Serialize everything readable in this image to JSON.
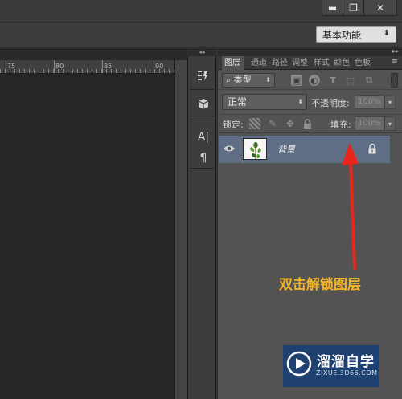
{
  "window": {
    "minimize_glyph": "▬",
    "restore_glyph": "❐",
    "close_glyph": "✕"
  },
  "options_bar": {
    "workspace": "基本功能"
  },
  "ruler": {
    "labels": [
      "75",
      "80",
      "85",
      "90"
    ]
  },
  "icon_strip": {
    "collapse_glyph": "◂◂",
    "text_tool_glyph": "A|",
    "paragraph_glyph": "¶"
  },
  "layers_panel": {
    "expand_glyph": "▸▸",
    "tabs": [
      "图层",
      "通道",
      "路径",
      "调整",
      "样式",
      "颜色",
      "色板"
    ],
    "menu_glyph": "≡",
    "filter": {
      "kind": "类型"
    },
    "blend_mode": "正常",
    "opacity_label": "不透明度:",
    "opacity_value": "100%",
    "lock_label": "锁定:",
    "fill_label": "填充:",
    "fill_value": "100%",
    "layers": [
      {
        "name": "背景",
        "visible": true,
        "locked": true,
        "selected": true
      }
    ]
  },
  "annotation": {
    "text": "双击解锁图层",
    "color": "#f2b42a",
    "arrow_color": "#e8261c"
  },
  "watermark": {
    "title": "溜溜自学",
    "url": "ZIXUE.3D66.COM"
  }
}
